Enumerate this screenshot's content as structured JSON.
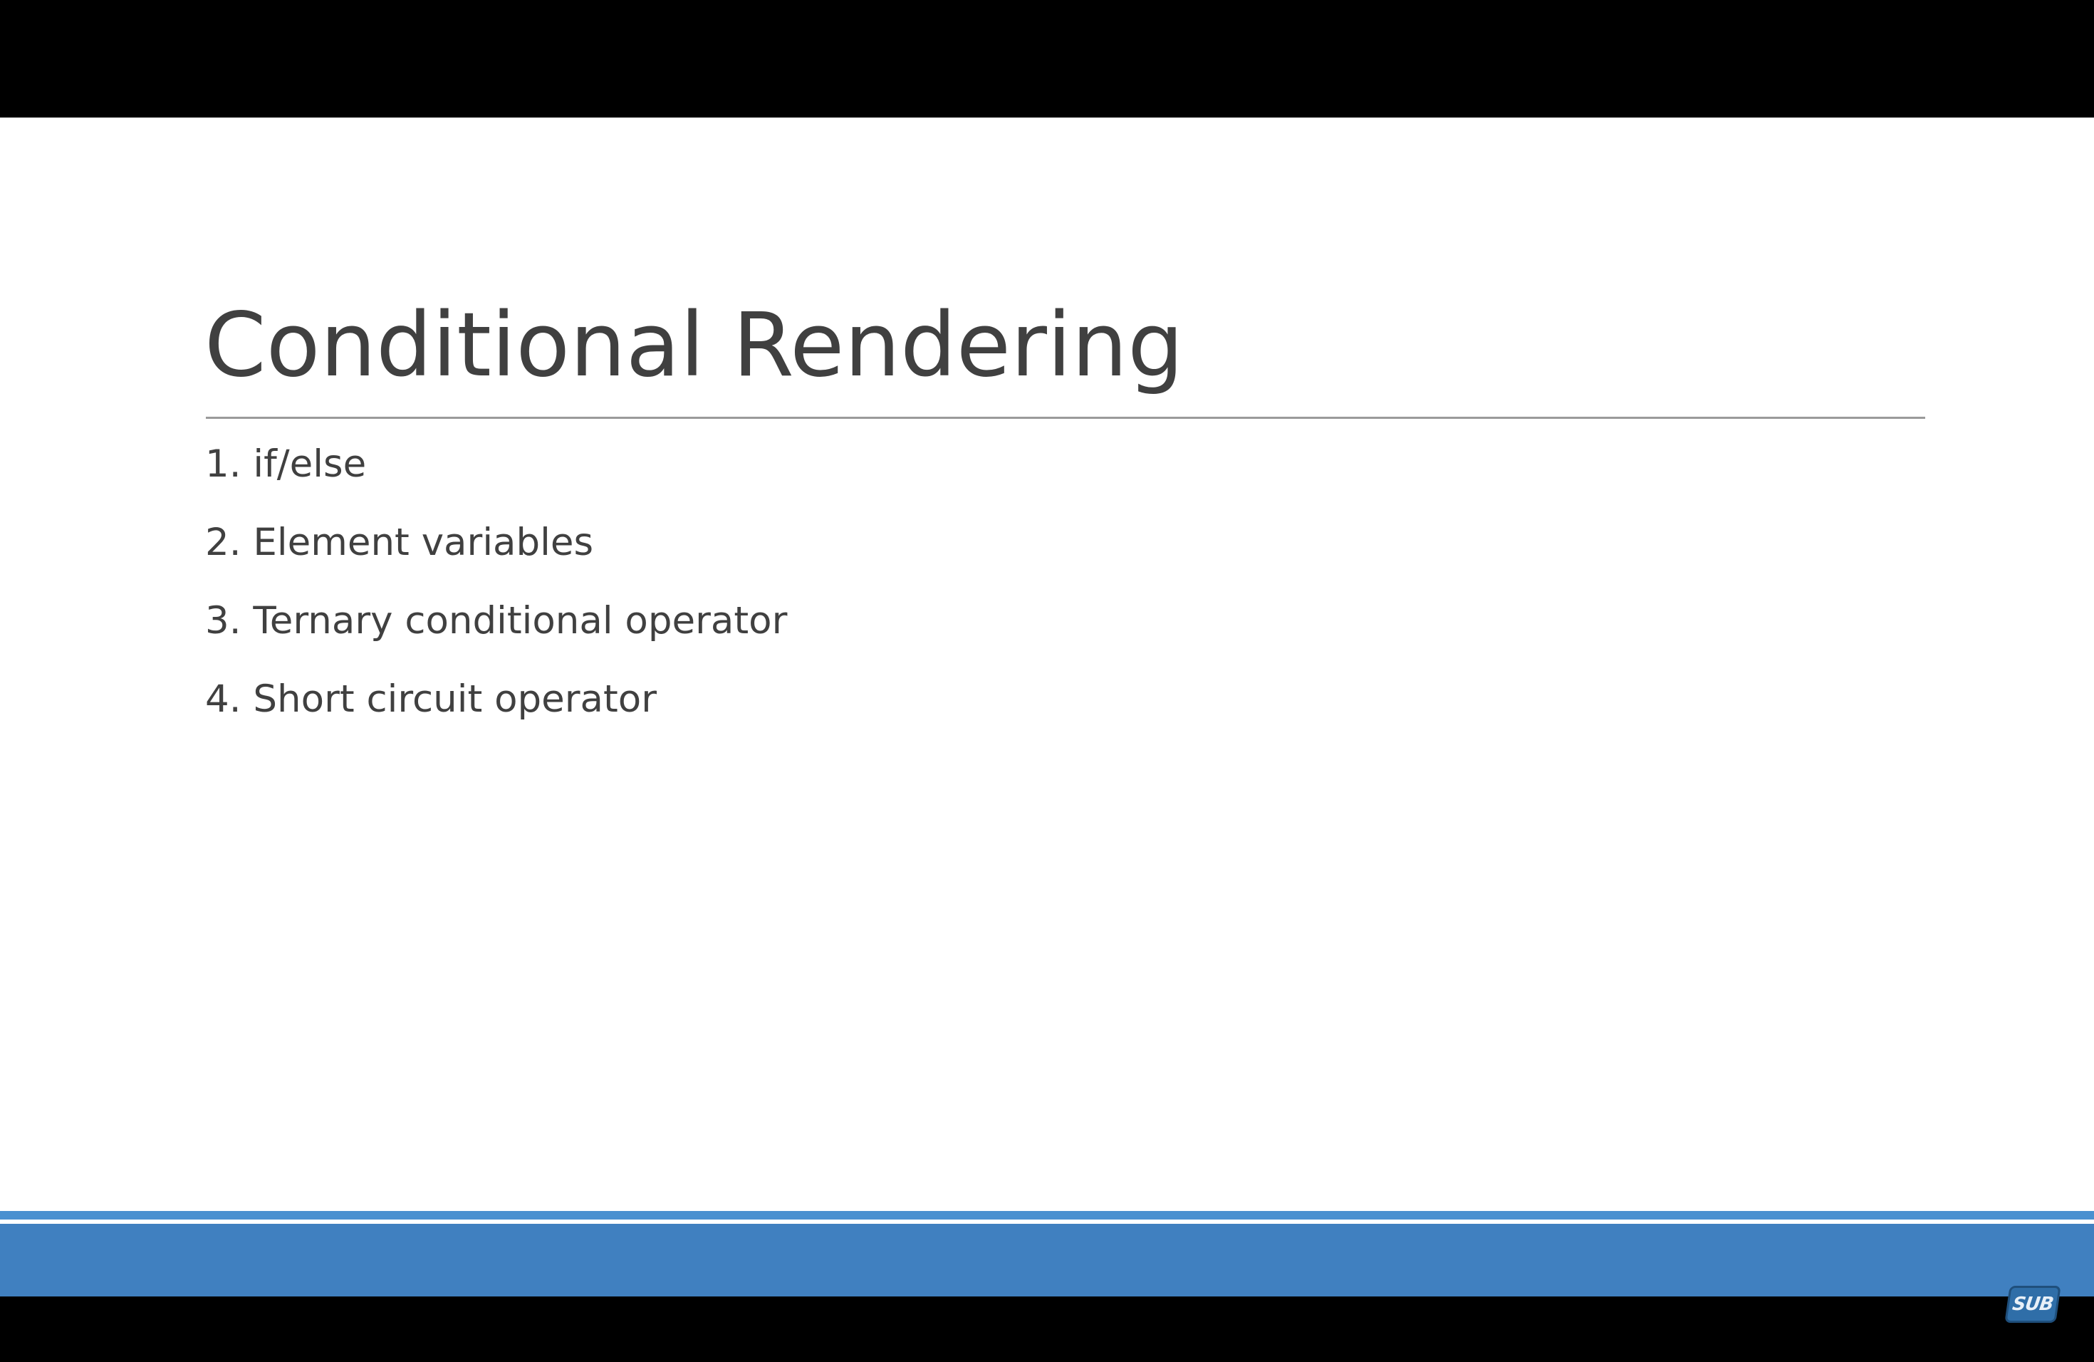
{
  "slide": {
    "title": "Conditional Rendering",
    "items": [
      "1. if/else",
      "2. Element variables",
      "3. Ternary conditional operator",
      "4. Short circuit operator"
    ]
  },
  "overlay": {
    "logo_text": "SUB"
  },
  "colors": {
    "title_text": "#404040",
    "body_text": "#404040",
    "footer_accent": "#4080c0",
    "letterbox": "#000000",
    "slide_background": "#ffffff"
  }
}
